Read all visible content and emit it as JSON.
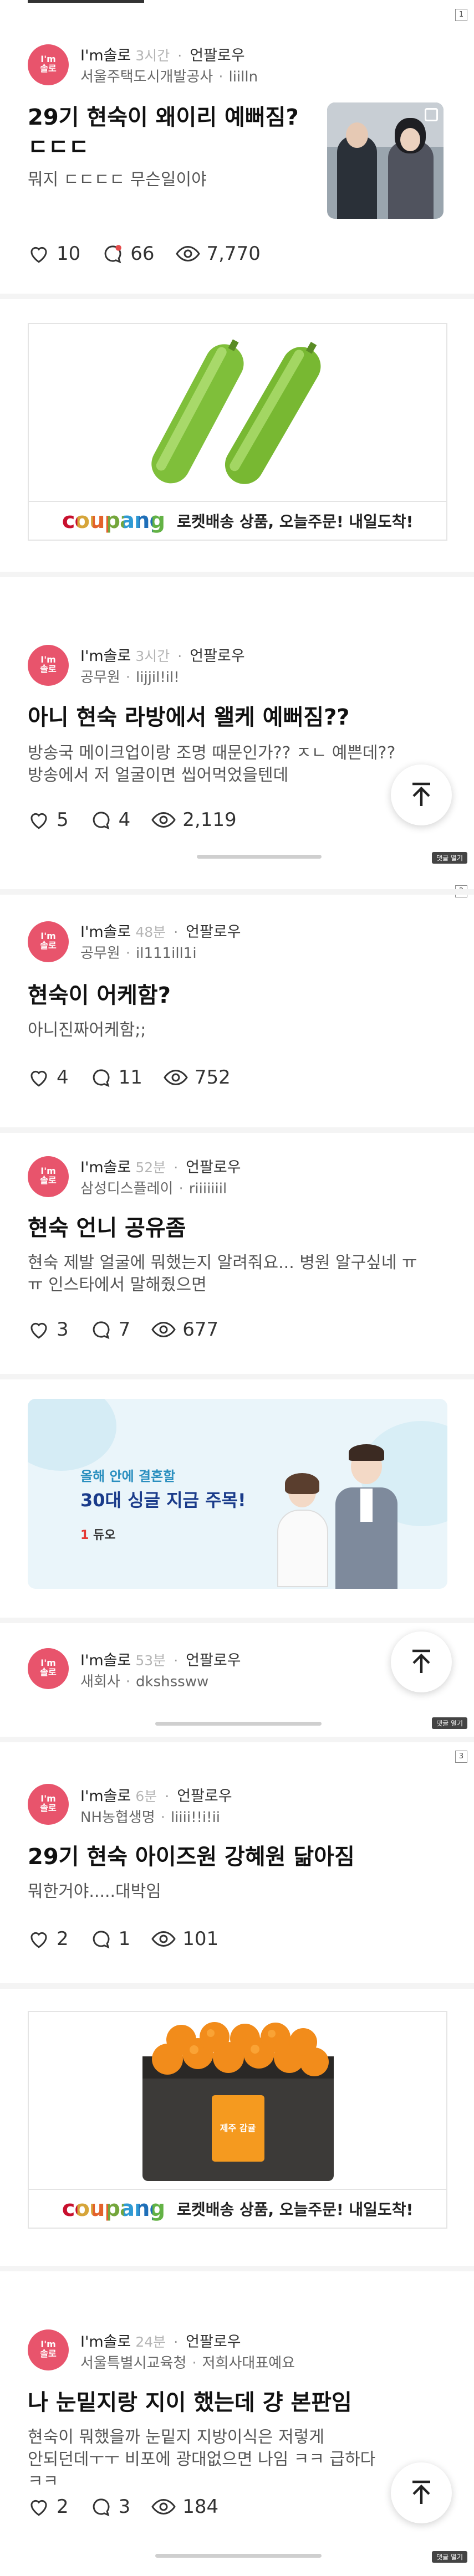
{
  "page_markers": [
    "1",
    "2",
    "3"
  ],
  "comment_button_label": "댓글 열기",
  "posts": [
    {
      "nickname": "I'm솔로",
      "time": "3시간",
      "follow": "언팔로우",
      "company": "서울주택도시개발공사",
      "user": "liilln",
      "title": "29기 현숙이 왜이리 예뻐짐? ㄷㄷㄷ",
      "body": "뭐지 ㄷㄷㄷㄷ 무슨일이야",
      "likes": "10",
      "comments": "66",
      "views": "7,770"
    },
    {
      "nickname": "I'm솔로",
      "time": "3시간",
      "follow": "언팔로우",
      "company": "공무원",
      "user": "lijjil!il!",
      "title": "아니 현숙 라방에서 왤케 예뻐짐??",
      "body": "방송국 메이크업이랑 조명 때문인가?? ㅈㄴ 예쁜데??\n방송에서 저 얼굴이면 씹어먹었을텐데",
      "likes": "5",
      "comments": "4",
      "views": "2,119"
    },
    {
      "nickname": "I'm솔로",
      "time": "48분",
      "follow": "언팔로우",
      "company": "공무원",
      "user": "il111ill1i",
      "title": "현숙이 어케함?",
      "body": "아니진짜어케함;;",
      "likes": "4",
      "comments": "11",
      "views": "752"
    },
    {
      "nickname": "I'm솔로",
      "time": "52분",
      "follow": "언팔로우",
      "company": "삼성디스플레이",
      "user": "riiiiiiil",
      "title": "현숙 언니 공유좀",
      "body": "현숙 제발 얼굴에 뭐했는지 알려줘요... 병원 알구싶네 ㅠ\nㅠ 인스타에서 말해줬으면",
      "likes": "3",
      "comments": "7",
      "views": "677"
    },
    {
      "nickname": "I'm솔로",
      "time": "53분",
      "follow": "언팔로우",
      "company": "새회사",
      "user": "dkshssww"
    },
    {
      "nickname": "I'm솔로",
      "time": "6분",
      "follow": "언팔로우",
      "company": "NH농협생명",
      "user": "liiii!!i!ii",
      "title": "29기 현숙 아이즈원 강혜원 닮아짐",
      "body": "뭐한거야.....대박임",
      "likes": "2",
      "comments": "1",
      "views": "101"
    },
    {
      "nickname": "I'm솔로",
      "time": "24분",
      "follow": "언팔로우",
      "company": "서울특별시교육청",
      "user": "저희사대표예요",
      "title": "나 눈밑지랑 지이 했는데 걍 본판임",
      "body": "현숙이 뭐했을까 눈밑지 지방이식은 저렇게\n안되던데ㅜㅜ 비포에 광대없으면 나임 ㅋㅋ 급하다 ㅋㅋ",
      "likes": "2",
      "comments": "3",
      "views": "184"
    }
  ],
  "avatar_text": [
    "I'm",
    "솔로"
  ],
  "ads": [
    {
      "brand": "coupang",
      "text": "로켓배송 상품, 오늘주문! 내일도착!",
      "image": "cucumbers"
    },
    {
      "line1": "올해 안에 결혼할",
      "line2": "30대 싱글 지금 주목!",
      "brand": "듀오"
    },
    {
      "brand": "coupang",
      "text": "로켓배송 상품, 오늘주문! 내일도착!",
      "image": "tangerine-box"
    }
  ],
  "tangerine_box_label": "제주 감귤",
  "colors": {
    "avatar": "#e8546c",
    "coupang_c": "#c8102e",
    "coupang_o": "#d6a53a",
    "coupang_u": "#e3612b",
    "coupang_p": "#74a63b",
    "coupang_a": "#2f9ad4",
    "coupang_n": "#1f6fb8",
    "coupang_g": "#63b245"
  }
}
